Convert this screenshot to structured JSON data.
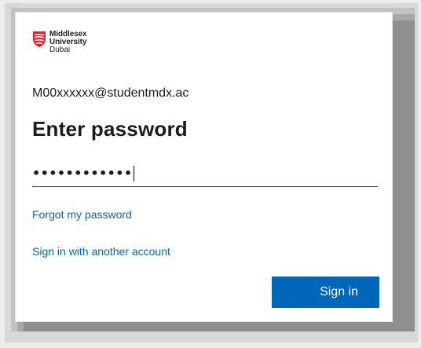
{
  "brand": {
    "line1": "Middlesex",
    "line2": "University",
    "line3": "Dubai",
    "logo_color": "#e4202a"
  },
  "account": {
    "email": "M00xxxxxx@studentmdx.ac"
  },
  "page": {
    "title": "Enter password"
  },
  "password_field": {
    "masked_value": "••••••••••••"
  },
  "links": {
    "forgot": "Forgot my password",
    "other_account": "Sign in with another account"
  },
  "actions": {
    "sign_in": "Sign in"
  },
  "colors": {
    "accent": "#0067b8",
    "text": "#1b1b1b"
  }
}
